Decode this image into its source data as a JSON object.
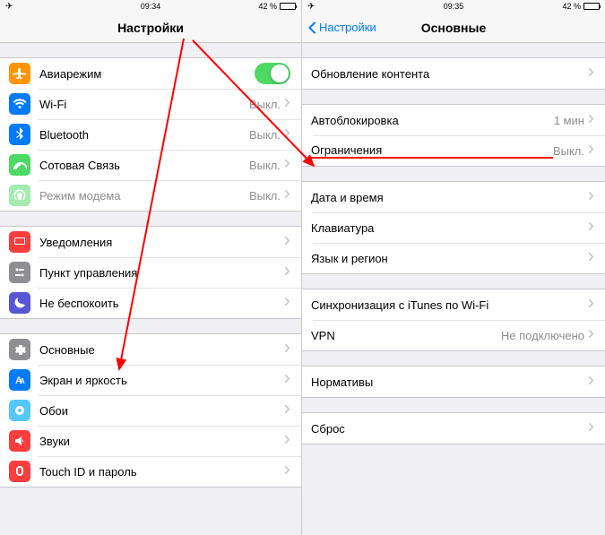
{
  "left": {
    "status": {
      "time": "09:34",
      "battery": "42 %"
    },
    "title": "Настройки",
    "g1": [
      {
        "label": "Авиарежим",
        "icon": "airplane",
        "toggle": true
      },
      {
        "label": "Wi-Fi",
        "icon": "wifi",
        "value": "Выкл."
      },
      {
        "label": "Bluetooth",
        "icon": "bt",
        "value": "Выкл."
      },
      {
        "label": "Сотовая Связь",
        "icon": "cell",
        "value": "Выкл."
      },
      {
        "label": "Режим модема",
        "icon": "hotspot",
        "value": "Выкл.",
        "disabled": true
      }
    ],
    "g2": [
      {
        "label": "Уведомления",
        "icon": "notif"
      },
      {
        "label": "Пункт управления",
        "icon": "control"
      },
      {
        "label": "Не беспокоить",
        "icon": "dnd"
      }
    ],
    "g3": [
      {
        "label": "Основные",
        "icon": "general"
      },
      {
        "label": "Экран и яркость",
        "icon": "display"
      },
      {
        "label": "Обои",
        "icon": "wall"
      },
      {
        "label": "Звуки",
        "icon": "sound"
      },
      {
        "label": "Touch ID и пароль",
        "icon": "touch"
      }
    ]
  },
  "right": {
    "status": {
      "time": "09:35",
      "battery": "42 %"
    },
    "back": "Настройки",
    "title": "Основные",
    "g1": [
      {
        "label": "Обновление контента"
      }
    ],
    "g2": [
      {
        "label": "Автоблокировка",
        "value": "1 мин"
      },
      {
        "label": "Ограничения",
        "value": "Выкл.",
        "underline": true
      }
    ],
    "g3": [
      {
        "label": "Дата и время"
      },
      {
        "label": "Клавиатура"
      },
      {
        "label": "Язык и регион"
      }
    ],
    "g4": [
      {
        "label": "Синхронизация с iTunes по Wi-Fi"
      },
      {
        "label": "VPN",
        "value": "Не подключено"
      }
    ],
    "g5": [
      {
        "label": "Нормативы"
      }
    ],
    "g6": [
      {
        "label": "Сброс"
      }
    ]
  }
}
